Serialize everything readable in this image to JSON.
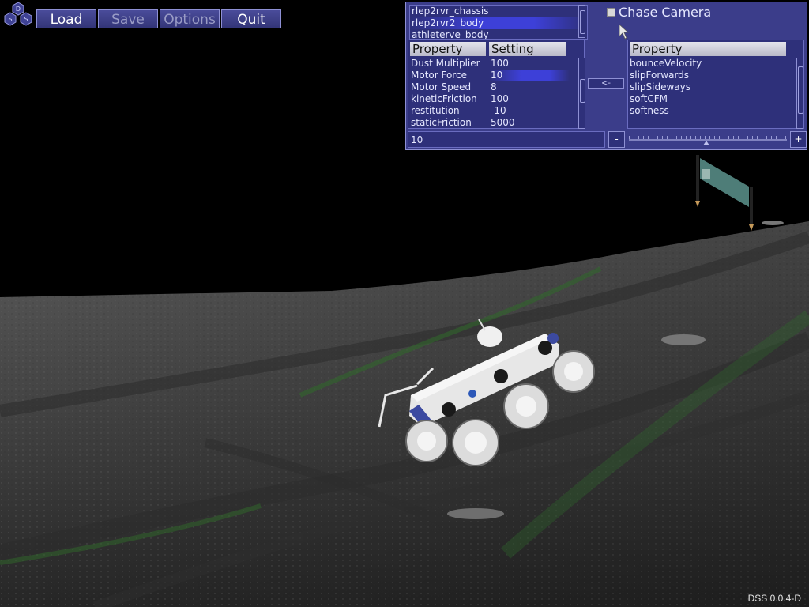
{
  "logo": {
    "letters": [
      "D",
      "S",
      "S"
    ],
    "icon": "dss-hexagon-logo"
  },
  "menu": {
    "load_label": "Load",
    "save_label": "Save",
    "options_label": "Options",
    "quit_label": "Quit"
  },
  "objects": {
    "items": [
      "rlep2rvr_chassis",
      "rlep2rvr2_body",
      "athleterve_body"
    ],
    "selected": "rlep2rvr2_body"
  },
  "chase_camera": {
    "label": "Chase Camera",
    "checked": false
  },
  "settings_table": {
    "columns": [
      "Property",
      "Setting"
    ],
    "rows": [
      {
        "property": "Dust Multiplier",
        "setting": "100"
      },
      {
        "property": "Motor Force",
        "setting": "10"
      },
      {
        "property": "Motor Speed",
        "setting": "8"
      },
      {
        "property": "kineticFriction",
        "setting": "100"
      },
      {
        "property": "restitution",
        "setting": "-10"
      },
      {
        "property": "staticFriction",
        "setting": "5000"
      }
    ],
    "selected_row": "Motor Force"
  },
  "transfer_button_label": "<-",
  "available_table": {
    "column": "Property",
    "rows": [
      "bounceVelocity",
      "slipForwards",
      "slipSideways",
      "softCFM",
      "softness"
    ]
  },
  "value_field": {
    "value": "10"
  },
  "decrement_label": "-",
  "increment_label": "+",
  "version": "DSS 0.0.4-D",
  "colors": {
    "panel": "#3b3d8a",
    "list_bg": "#2e307a",
    "highlight": "#3d40d8",
    "border": "#8e90d4"
  }
}
